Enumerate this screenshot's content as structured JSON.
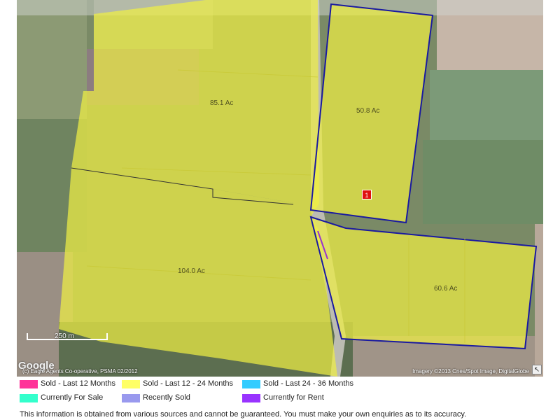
{
  "map": {
    "parcels": [
      {
        "id": "p1",
        "area_label": "85.1 Ac"
      },
      {
        "id": "p2",
        "area_label": "50.8 Ac"
      },
      {
        "id": "p3",
        "area_label": "104.0 Ac"
      },
      {
        "id": "p4",
        "area_label": "60.6 Ac"
      }
    ],
    "marker_label": "1",
    "scale_label": "250 m",
    "google_logo_text": "Google",
    "copyright_text": "(c) Eagle Agents Co-operative, PSMA 02/2012",
    "imagery_text": "Imagery ©2013 Cnes/Spot Image, DigitalGlobe",
    "corner_icon": "resize-arrow-icon"
  },
  "legend": {
    "items": [
      {
        "label": "Sold - Last 12 Months",
        "color": "#ff3399"
      },
      {
        "label": "Sold - Last 12 - 24 Months",
        "color": "#ffff66"
      },
      {
        "label": "Sold - Last 24 - 36 Months",
        "color": "#33ccff"
      },
      {
        "label": "Currently For Sale",
        "color": "#33ffcc"
      },
      {
        "label": "Recently Sold",
        "color": "#9999ee"
      },
      {
        "label": "Currently for Rent",
        "color": "#9933ff"
      }
    ]
  },
  "disclaimer": "This information is obtained from various sources and cannot be guaranteed. You must make your own enquiries as to its accuracy.",
  "colors": {
    "highlight_fill": "#eeee44",
    "selection_outline": "#1a1aa0"
  }
}
